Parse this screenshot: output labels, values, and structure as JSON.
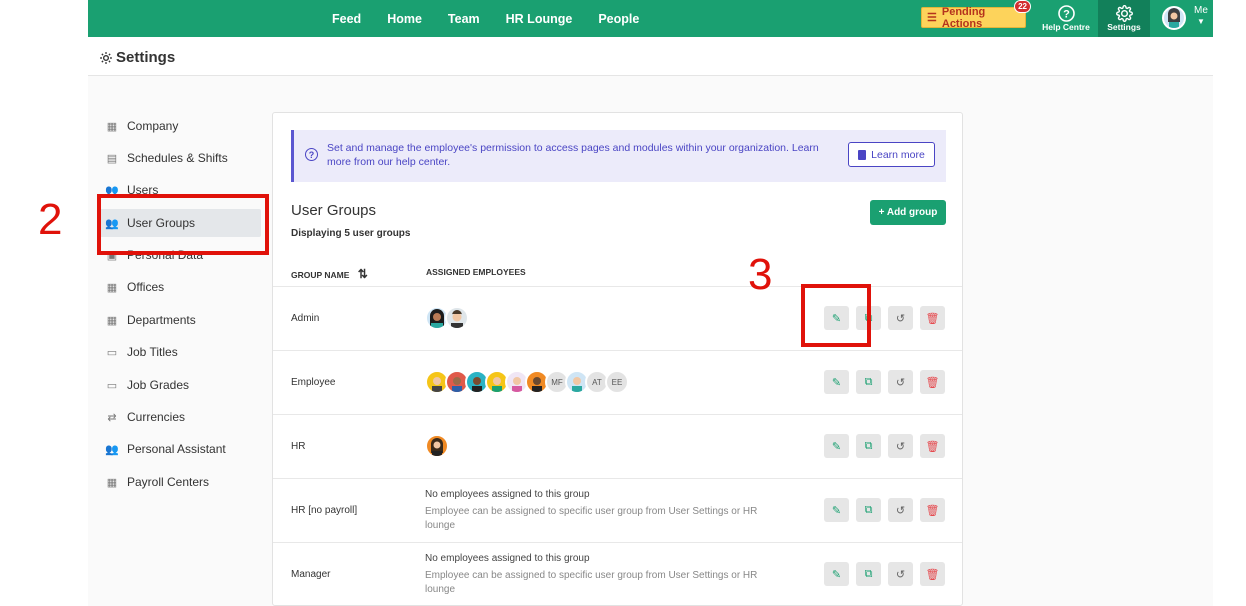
{
  "topbar": {
    "nav": [
      "Feed",
      "Home",
      "Team",
      "HR Lounge",
      "People"
    ],
    "pending_label": "Pending Actions",
    "pending_count": "22",
    "help_label": "Help Centre",
    "settings_label": "Settings",
    "me_label": "Me"
  },
  "page": {
    "title": "Settings"
  },
  "sidebar": {
    "items": [
      {
        "label": "Company",
        "icon": "building-icon"
      },
      {
        "label": "Schedules & Shifts",
        "icon": "calendar-icon"
      },
      {
        "label": "Users",
        "icon": "users-icon"
      },
      {
        "label": "User Groups",
        "icon": "user-group-icon"
      },
      {
        "label": "Personal Data",
        "icon": "id-card-icon"
      },
      {
        "label": "Offices",
        "icon": "building-icon"
      },
      {
        "label": "Departments",
        "icon": "building-icon"
      },
      {
        "label": "Job Titles",
        "icon": "briefcase-icon"
      },
      {
        "label": "Job Grades",
        "icon": "briefcase-icon"
      },
      {
        "label": "Currencies",
        "icon": "exchange-icon"
      },
      {
        "label": "Personal Assistant",
        "icon": "users-icon"
      },
      {
        "label": "Payroll Centers",
        "icon": "building-icon"
      }
    ],
    "active": "User Groups"
  },
  "info": {
    "text": "Set and manage the employee's permission to access pages and modules within your organization. Learn more from our help center.",
    "learn_more": "Learn more"
  },
  "groups": {
    "title": "User Groups",
    "subtitle": "Displaying 5 user groups",
    "add_button": "+ Add group",
    "col_name": "GROUP NAME",
    "col_assigned": "ASSIGNED EMPLOYEES",
    "empty_title": "No employees assigned to this group",
    "empty_hint": "Employee can be assigned to specific user group from User Settings or HR lounge",
    "rows": [
      {
        "name": "Admin"
      },
      {
        "name": "Employee",
        "initials": [
          "MF",
          "AT",
          "EE"
        ]
      },
      {
        "name": "HR"
      },
      {
        "name": "HR [no payroll]"
      },
      {
        "name": "Manager"
      }
    ]
  },
  "annotations": {
    "step2": "2",
    "step3": "3"
  },
  "colors": {
    "brand": "#1aa071",
    "accent": "#4a45c4",
    "danger": "#e5484d",
    "annotation": "#e0120a"
  }
}
